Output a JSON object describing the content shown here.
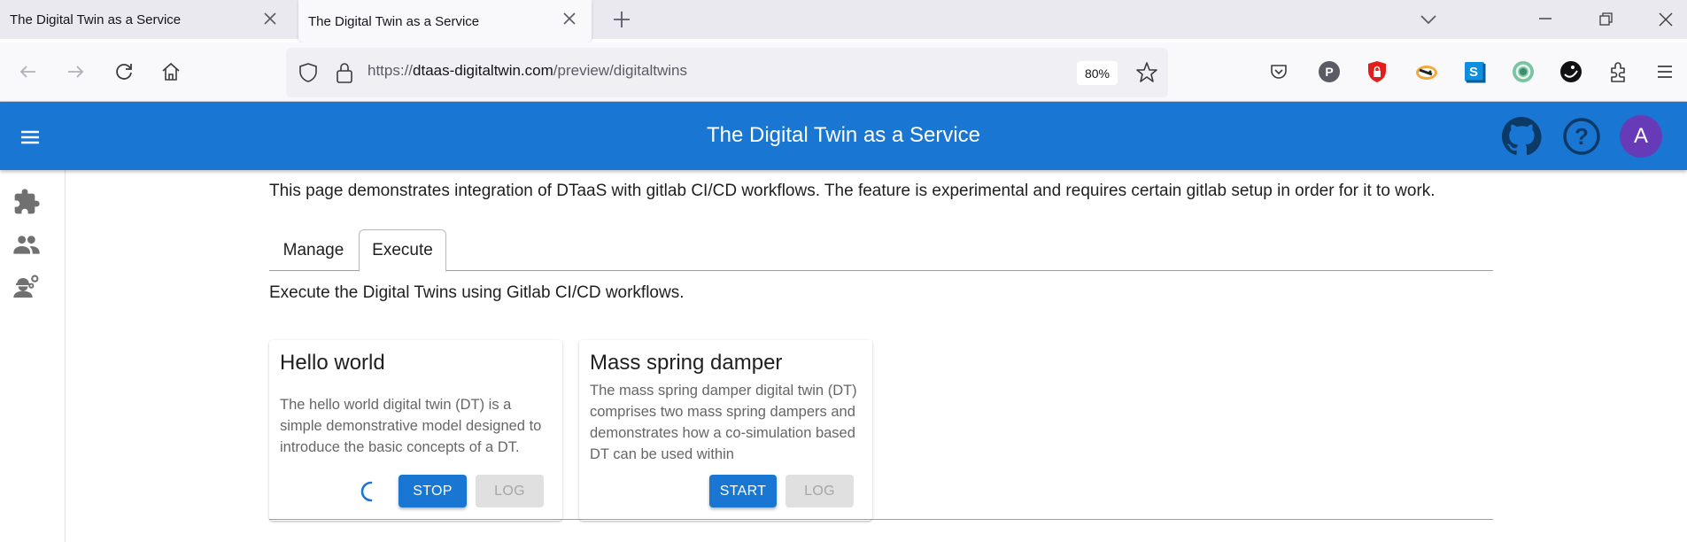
{
  "browser": {
    "tabs": [
      {
        "title": "The Digital Twin as a Service",
        "active": false
      },
      {
        "title": "The Digital Twin as a Service",
        "active": true
      }
    ],
    "url": {
      "scheme": "https://",
      "host": "dtaas-digitaltwin.com",
      "path": "/preview/digitaltwins"
    },
    "zoom_level": "80%",
    "extensions": [
      "pocket-icon",
      "p-extension-icon",
      "lock-shield-extension-icon",
      "badger-extension-icon",
      "s-extension-icon",
      "green-circle-extension-icon",
      "dark-face-extension-icon",
      "extensions-puzzle-icon",
      "app-menu-icon"
    ]
  },
  "appbar": {
    "title": "The Digital Twin as a Service",
    "avatar_initial": "A",
    "avatar_color": "#673ab7",
    "brand_color": "#1976d2"
  },
  "sidebar": {
    "items": [
      {
        "icon": "puzzle-icon",
        "name": "library"
      },
      {
        "icon": "people-icon",
        "name": "digital-twins"
      },
      {
        "icon": "engineer-gears-icon",
        "name": "sim-environments"
      }
    ]
  },
  "main": {
    "intro": "This page demonstrates integration of DTaaS with gitlab CI/CD workflows. The feature is experimental and requires certain gitlab setup in order for it to work.",
    "tabs": [
      {
        "label": "Manage",
        "selected": false
      },
      {
        "label": "Execute",
        "selected": true
      }
    ],
    "subtitle": "Execute the Digital Twins using Gitlab CI/CD workflows.",
    "cards": [
      {
        "title": "Hello world",
        "description": "The hello world digital twin (DT) is a simple demonstrative model designed to introduce the basic concepts of a DT.",
        "running": true,
        "action_label": "STOP",
        "log_label": "LOG"
      },
      {
        "title": "Mass spring damper",
        "description": "The mass spring damper digital twin (DT) comprises two mass spring dampers and demonstrates how a co-simulation based DT can be used within",
        "running": false,
        "action_label": "START",
        "log_label": "LOG"
      }
    ]
  }
}
